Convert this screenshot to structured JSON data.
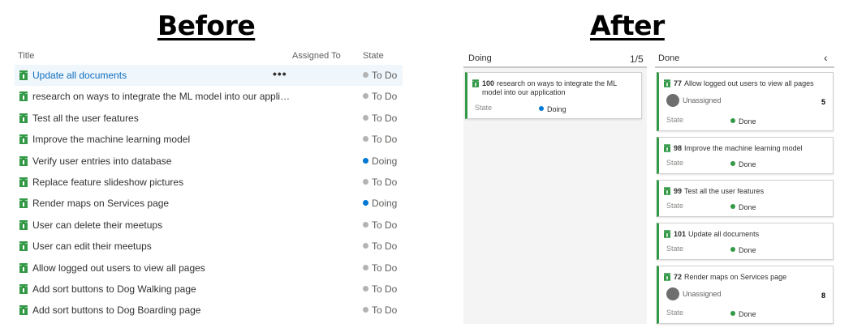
{
  "headings": {
    "before": "Before",
    "after": "After"
  },
  "colors": {
    "doing": "#0078d4",
    "todo": "#b3b3b3",
    "done": "#339947",
    "icon": "#339947"
  },
  "list": {
    "columns": {
      "title": "Title",
      "assigned": "Assigned To",
      "state": "State"
    },
    "more_label": "•••",
    "rows": [
      {
        "title": "Update all documents",
        "state": "To Do",
        "status": "todo"
      },
      {
        "title": "research on ways to integrate the ML model into our applica...",
        "state": "To Do",
        "status": "todo"
      },
      {
        "title": "Test all the user features",
        "state": "To Do",
        "status": "todo"
      },
      {
        "title": "Improve the machine learning model",
        "state": "To Do",
        "status": "todo"
      },
      {
        "title": "Verify user entries into database",
        "state": "Doing",
        "status": "doing"
      },
      {
        "title": "Replace feature slideshow pictures",
        "state": "To Do",
        "status": "todo"
      },
      {
        "title": "Render maps on Services page",
        "state": "Doing",
        "status": "doing"
      },
      {
        "title": "User can delete their meetups",
        "state": "To Do",
        "status": "todo"
      },
      {
        "title": "User can edit their meetups",
        "state": "To Do",
        "status": "todo"
      },
      {
        "title": "Allow logged out users to view all pages",
        "state": "To Do",
        "status": "todo"
      },
      {
        "title": "Add sort buttons to Dog Walking page",
        "state": "To Do",
        "status": "todo"
      },
      {
        "title": "Add sort buttons to Dog Boarding page",
        "state": "To Do",
        "status": "todo"
      }
    ]
  },
  "board": {
    "doing": {
      "label": "Doing",
      "count": "1/5",
      "cards": [
        {
          "id": "100",
          "title": "research on ways to integrate the ML model into our application",
          "state_label": "State",
          "state": "Doing"
        }
      ]
    },
    "done": {
      "label": "Done",
      "collapse_icon": "‹",
      "cards": [
        {
          "id": "77",
          "title": "Allow logged out users to view all pages",
          "assigned": "Unassigned",
          "effort": "5",
          "state_label": "State",
          "state": "Done"
        },
        {
          "id": "98",
          "title": "Improve the machine learning model",
          "state_label": "State",
          "state": "Done"
        },
        {
          "id": "99",
          "title": "Test all the user features",
          "state_label": "State",
          "state": "Done"
        },
        {
          "id": "101",
          "title": "Update all documents",
          "state_label": "State",
          "state": "Done"
        },
        {
          "id": "72",
          "title": "Render maps on Services page",
          "assigned": "Unassigned",
          "effort": "8",
          "state_label": "State",
          "state": "Done"
        }
      ]
    }
  }
}
